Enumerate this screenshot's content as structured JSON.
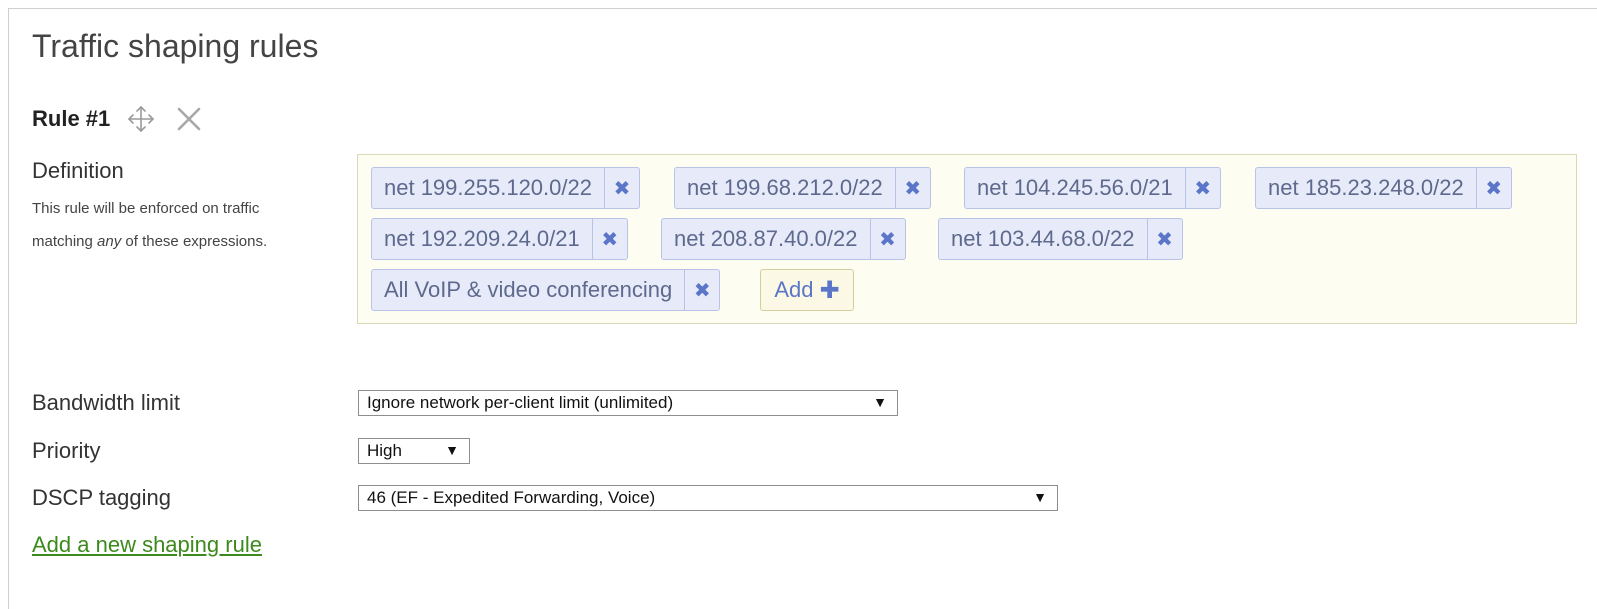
{
  "page_title": "Traffic shaping rules",
  "rule": {
    "title": "Rule #1",
    "move_icon": "move-arrows-icon",
    "delete_icon": "close-x-icon",
    "definition_label": "Definition",
    "definition_help_1": "This rule will be enforced on traffic matching ",
    "definition_help_em": "any",
    "definition_help_2": " of these expressions.",
    "expressions": [
      {
        "label": "net 199.255.120.0/22",
        "remove": "✖"
      },
      {
        "label": "net 199.68.212.0/22",
        "remove": "✖"
      },
      {
        "label": "net 104.245.56.0/21",
        "remove": "✖"
      },
      {
        "label": "net 185.23.248.0/22",
        "remove": "✖"
      },
      {
        "label": "net 192.209.24.0/21",
        "remove": "✖"
      },
      {
        "label": "net 208.87.40.0/22",
        "remove": "✖"
      },
      {
        "label": "net 103.44.68.0/22",
        "remove": "✖"
      },
      {
        "label": "All VoIP & video conferencing",
        "remove": "✖"
      }
    ],
    "add_label": "Add",
    "add_symbol": "✚",
    "bandwidth_label": "Bandwidth limit",
    "bandwidth_value": "Ignore network per-client limit (unlimited)",
    "priority_label": "Priority",
    "priority_value": "High",
    "dscp_label": "DSCP tagging",
    "dscp_value": "46 (EF - Expedited Forwarding, Voice)",
    "select_arrow": "▼"
  },
  "add_rule_link": "Add a new shaping rule",
  "colors": {
    "token_bg": "#e7ebf9",
    "token_text": "#5e6a8d",
    "accent_blue": "#5b76c8",
    "definition_bg": "#fdfdf1",
    "link_green": "#3c8a1c"
  }
}
